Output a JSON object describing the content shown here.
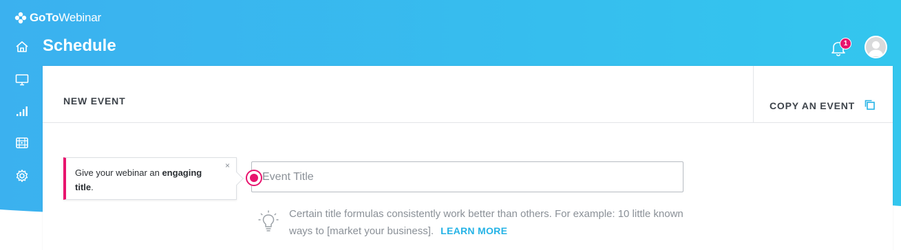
{
  "app": {
    "logo_bold": "GoTo",
    "logo_regular": "Webinar",
    "page_title": "Schedule"
  },
  "colors": {
    "header_start": "#3bb4ef",
    "header_end": "#2fc4ee",
    "accent": "#e8146e",
    "link": "#25b3e6"
  },
  "sidebar": {
    "items": [
      {
        "icon": "home-icon"
      },
      {
        "icon": "monitor-icon"
      },
      {
        "icon": "analytics-icon"
      },
      {
        "icon": "recordings-icon"
      },
      {
        "icon": "gear-icon"
      }
    ]
  },
  "header": {
    "notification_count": "1",
    "bell_icon": "bell-icon",
    "avatar_icon": "user-avatar-icon"
  },
  "card": {
    "tab_new": "NEW EVENT",
    "copy_label": "COPY AN EVENT",
    "copy_icon": "copy-icon"
  },
  "tooltip": {
    "text_before": "Give your webinar an ",
    "text_bold_1": "engaging",
    "text_bold_2": "title",
    "text_after": ".",
    "close": "×"
  },
  "form": {
    "title_value": "",
    "title_placeholder": "Event Title"
  },
  "hint": {
    "icon": "lightbulb-icon",
    "text": "Certain title formulas consistently work better than others. For example: 10 little known ways to [market your business].",
    "link": "LEARN MORE"
  }
}
